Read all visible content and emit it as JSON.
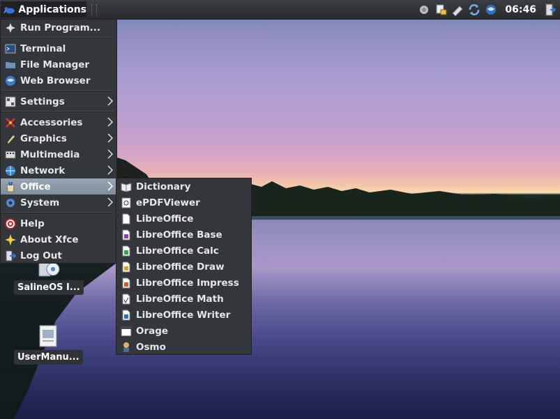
{
  "panel": {
    "applications_label": "Applications",
    "clock": "06:46",
    "tray_icons": [
      "keyboard-icon",
      "network-lock-icon",
      "usb-icon",
      "update-icon",
      "browser-icon"
    ]
  },
  "main_menu": {
    "items": [
      {
        "label": "Run Program...",
        "icon": "run-icon"
      },
      {
        "label": "Terminal",
        "icon": "terminal-icon"
      },
      {
        "label": "File Manager",
        "icon": "folder-icon"
      },
      {
        "label": "Web Browser",
        "icon": "globe-icon"
      },
      {
        "label": "Settings",
        "icon": "settings-icon"
      },
      {
        "label": "Accessories",
        "icon": "accessories-icon"
      },
      {
        "label": "Graphics",
        "icon": "graphics-icon"
      },
      {
        "label": "Multimedia",
        "icon": "multimedia-icon"
      },
      {
        "label": "Network",
        "icon": "network-icon"
      },
      {
        "label": "Office",
        "icon": "office-icon"
      },
      {
        "label": "System",
        "icon": "system-icon"
      },
      {
        "label": "Help",
        "icon": "help-icon"
      },
      {
        "label": "About Xfce",
        "icon": "star-icon"
      },
      {
        "label": "Log Out",
        "icon": "logout-icon"
      }
    ]
  },
  "office_menu": {
    "items": [
      {
        "label": "Dictionary"
      },
      {
        "label": "ePDFViewer"
      },
      {
        "label": "LibreOffice"
      },
      {
        "label": "LibreOffice Base"
      },
      {
        "label": "LibreOffice Calc"
      },
      {
        "label": "LibreOffice Draw"
      },
      {
        "label": "LibreOffice Impress"
      },
      {
        "label": "LibreOffice Math"
      },
      {
        "label": "LibreOffice Writer"
      },
      {
        "label": "Orage"
      },
      {
        "label": "Osmo"
      }
    ]
  },
  "desktop_icons": [
    {
      "label": "SalineOS I..."
    },
    {
      "label": "UserManu..."
    }
  ],
  "colors": {
    "menu_bg": "#33363a",
    "selected_bg": "#8a96a3",
    "panel_bg": "#2e3033"
  }
}
